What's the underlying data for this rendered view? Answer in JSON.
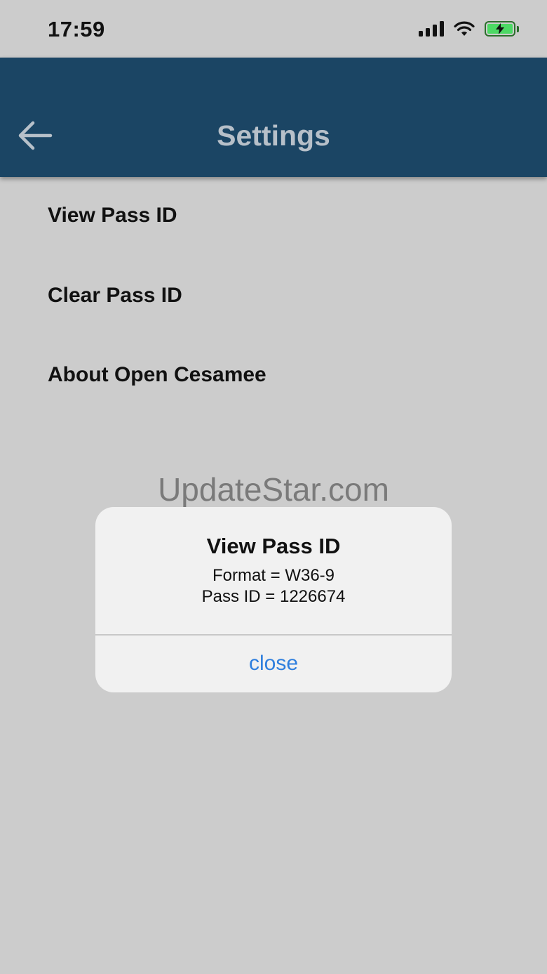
{
  "status_bar": {
    "time": "17:59",
    "icons": [
      "signal-icon",
      "wifi-icon",
      "battery-charging-icon"
    ]
  },
  "header": {
    "title": "Settings",
    "back_icon": "back-arrow-icon",
    "background": "#1b4564"
  },
  "menu": {
    "items": [
      {
        "label": "View Pass ID"
      },
      {
        "label": "Clear Pass ID"
      },
      {
        "label": "About Open Cesamee"
      }
    ]
  },
  "watermark": "UpdateStar.com",
  "alert": {
    "title": "View Pass ID",
    "lines": [
      "Format = W36-9",
      "Pass ID = 1226674"
    ],
    "close_label": "close",
    "accent": "#2f7fde"
  }
}
